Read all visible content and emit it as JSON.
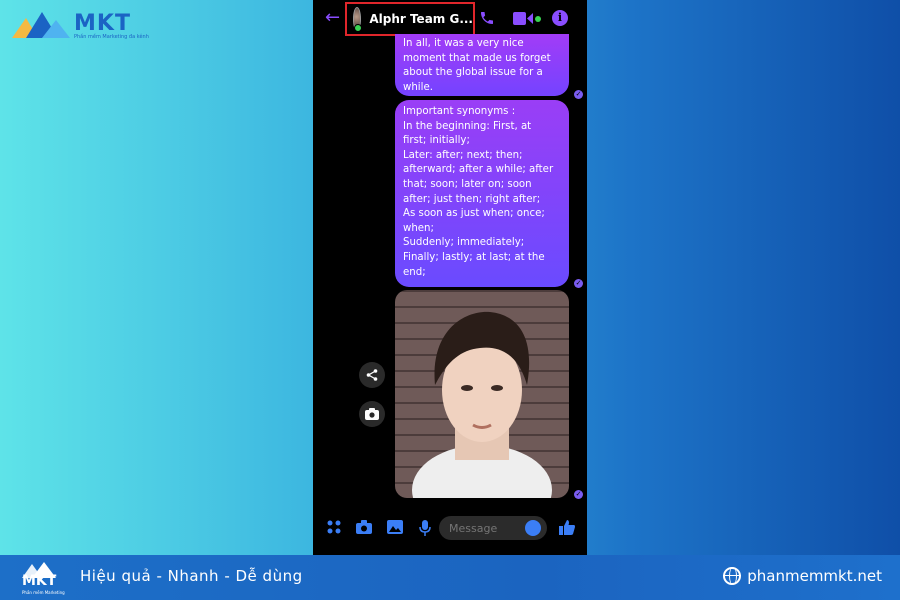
{
  "brand": {
    "logo_text": "MKT",
    "logo_sub": "Phần mềm Marketing đa kênh",
    "accent": "#1b63c4"
  },
  "chat": {
    "title": "Alphr Team G...",
    "bubble1": "In all, it was a very nice\nmoment that made us forget\nabout the global issue for a\nwhile.",
    "bubble2": "Important synonyms :\nIn the beginning:  First, at\nfirst; initially;\nLater:  after; next; then;\nafterward; after a while; after\nthat; soon; later on; soon\nafter; just then; right after;\nAs soon as just when; once;\nwhen;\nSuddenly; immediately;\nFinally; lastly; at last; at the\nend;",
    "message_placeholder": "Message",
    "accent": "#8a4dff"
  },
  "footer": {
    "logo_text": "MKT",
    "logo_sub": "Phần mềm Marketing",
    "tagline": "Hiệu quả - Nhanh  - Dễ dùng",
    "site": "phanmemmkt.net"
  },
  "icons": [
    "back-arrow-icon",
    "phone-icon",
    "video-icon",
    "info-icon",
    "share-icon",
    "camera-icon",
    "apps-icon",
    "image-icon",
    "mic-icon",
    "emoji-icon",
    "thumbs-up-icon",
    "globe-icon"
  ]
}
